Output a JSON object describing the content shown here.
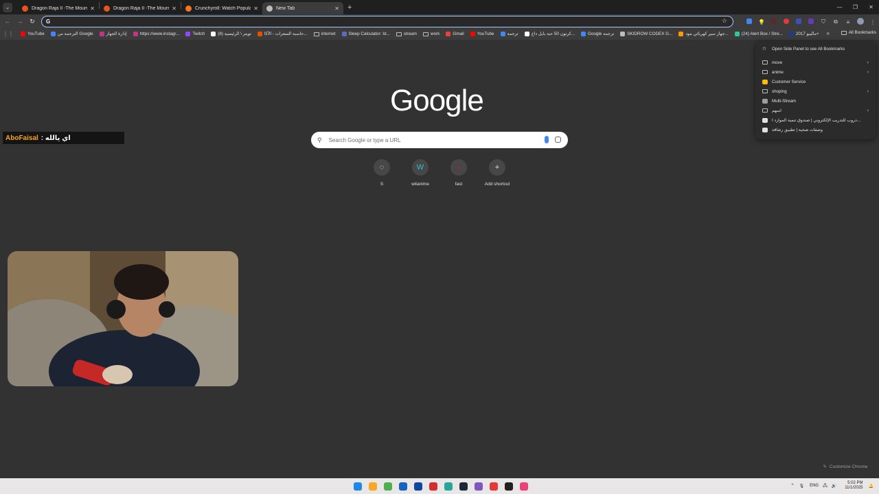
{
  "tabs": [
    {
      "label": "Dragon Raja II -The Mourner's",
      "color": "#e8541c",
      "active": false
    },
    {
      "label": "Dragon Raja II -The Mourner's",
      "color": "#e8541c",
      "active": false
    },
    {
      "label": "Crunchyroll: Watch Popular An",
      "color": "#f47521",
      "active": false
    },
    {
      "label": "New Tab",
      "color": "#bdbdbd",
      "active": true
    }
  ],
  "omnibox": {
    "placeholder": "",
    "g_label": "G"
  },
  "bookmarks": [
    {
      "label": "YouTube",
      "kind": "icon",
      "color": "#ff0000"
    },
    {
      "label": "الترجمة من Google",
      "kind": "icon",
      "color": "#4285f4"
    },
    {
      "label": "إدارة الجهاز",
      "kind": "icon",
      "color": "#c13584"
    },
    {
      "label": "https://www.instagr...",
      "kind": "icon",
      "color": "#c13584"
    },
    {
      "label": "Twitch",
      "kind": "icon",
      "color": "#9146ff"
    },
    {
      "label": "(8) تويتر \\ الرئيسية",
      "kind": "icon",
      "color": "#ffffff"
    },
    {
      "label": "حاسبة السعرات - الأكا...",
      "kind": "icon",
      "color": "#e65100"
    },
    {
      "label": "internet",
      "kind": "folder"
    },
    {
      "label": "Sleep Calculator: Id...",
      "kind": "icon",
      "color": "#5c6bc0"
    },
    {
      "label": "stream",
      "kind": "folder"
    },
    {
      "label": "work",
      "kind": "folder"
    },
    {
      "label": "Gmail",
      "kind": "icon",
      "color": "#ea4335"
    },
    {
      "label": "YouTube",
      "kind": "icon",
      "color": "#ff0000"
    },
    {
      "label": "ترجمة",
      "kind": "icon",
      "color": "#4285f4"
    },
    {
      "label": "كرتون 50 حبة بابل داخ...",
      "kind": "icon",
      "color": "#ffffff"
    },
    {
      "label": "Google ترجمة",
      "kind": "icon",
      "color": "#4285f4"
    },
    {
      "label": "SKIDROW CODEX G...",
      "kind": "icon",
      "color": "#bdbdbd"
    },
    {
      "label": "جهاز سير كهربائي مود...",
      "kind": "icon",
      "color": "#ff9900"
    },
    {
      "label": "(24) Alert Box / Stre...",
      "kind": "icon",
      "color": "#31c3a2"
    },
    {
      "label": "ماليبو 2017+",
      "kind": "icon",
      "color": "#1e3a8a"
    }
  ],
  "bookmarks_overflow": "»",
  "all_bookmarks_label": "All Bookmarks",
  "bookmarks_menu": {
    "header": "Open Side Panel to see All Bookmarks",
    "items": [
      {
        "label": "move",
        "kind": "folder",
        "submenu": true
      },
      {
        "label": "anime",
        "kind": "folder",
        "submenu": true
      },
      {
        "label": "Customer Service",
        "kind": "icon",
        "color": "#fbbc04",
        "submenu": false
      },
      {
        "label": "shoping",
        "kind": "folder",
        "submenu": true
      },
      {
        "label": "Multi-Stream",
        "kind": "icon",
        "color": "#9e9e9e",
        "submenu": false
      },
      {
        "label": "اسهم",
        "kind": "folder",
        "submenu": true
      },
      {
        "label": "دروب للتدريب الإلكتروني | صندوق تنمية الموارد ا...",
        "kind": "icon",
        "color": "#e0e0e0",
        "submenu": false
      },
      {
        "label": "وصفات صحية | تطبيق رشاقة",
        "kind": "icon",
        "color": "#e0e0e0",
        "submenu": false
      }
    ]
  },
  "logo": "Google",
  "search": {
    "placeholder": "Search Google or type a URL"
  },
  "shortcuts": [
    {
      "label": "S",
      "glyph": "◌",
      "color": "#e8e8e8"
    },
    {
      "label": "witanime",
      "glyph": "W",
      "color": "#26c6da"
    },
    {
      "label": "fast",
      "glyph": "◗",
      "color": "#b71c1c"
    },
    {
      "label": "Add shortcut",
      "glyph": "+",
      "color": "#e8e8e8"
    }
  ],
  "stream_overlay": {
    "name": "AboFaisal",
    "message": ": اي يالله"
  },
  "customize_label": "Customize Chrome",
  "taskbar": {
    "icons": [
      "#1e88e5",
      "#f9a825",
      "#4caf50",
      "#1565c0",
      "#0d47a1",
      "#d32f2f",
      "#26a69a",
      "#1b2838",
      "#7e57c2",
      "#e53935",
      "#212121",
      "#ec407a"
    ],
    "tray_lang": "ENG",
    "time": "5:02 PM",
    "date": "11/1/2025"
  },
  "colors": {
    "background": "#323232",
    "toolbar": "#3c3c3c",
    "tabstrip": "#1f1f1f",
    "accent": "#a8c7fa"
  }
}
